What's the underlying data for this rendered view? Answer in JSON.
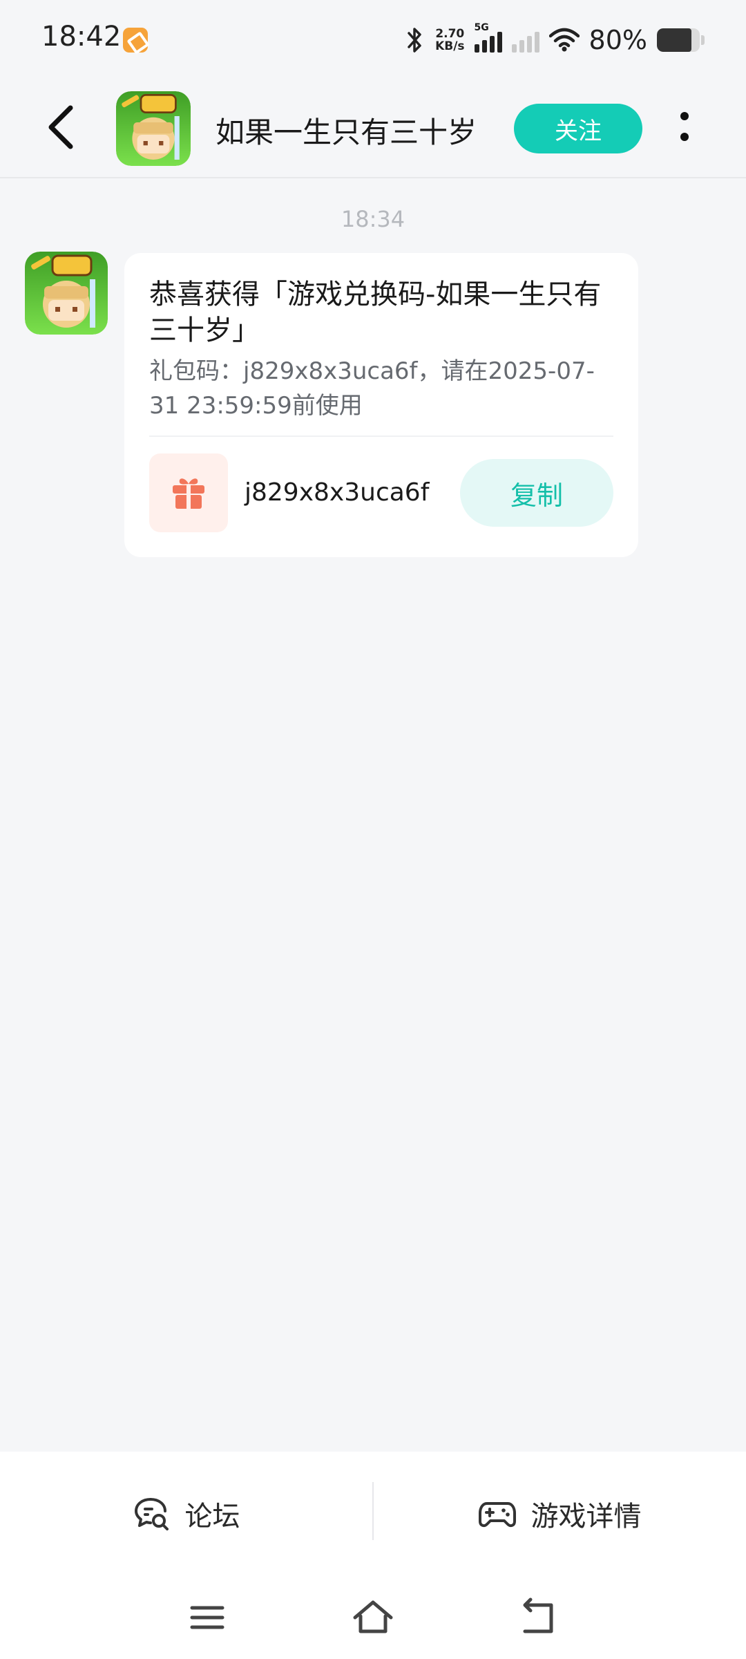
{
  "status_bar": {
    "time": "18:42",
    "speed_value": "2.70",
    "speed_unit": "KB/s",
    "network_label": "5G",
    "battery_text": "80%",
    "battery_level": 0.8
  },
  "header": {
    "title": "如果一生只有三十岁",
    "follow_label": "关注"
  },
  "chat": {
    "time": "18:34",
    "message": {
      "title": "恭喜获得「游戏兑换码-如果一生只有三十岁」",
      "description": "礼包码：j829x8x3uca6f，请在2025-07-31 23:59:59前使用",
      "code": "j829x8x3uca6f",
      "copy_label": "复制"
    }
  },
  "bottom_tabs": [
    {
      "label": "论坛",
      "icon": "forum-icon"
    },
    {
      "label": "游戏详情",
      "icon": "gamepad-icon"
    }
  ],
  "system_nav": [
    "menu-icon",
    "home-icon",
    "back-icon"
  ],
  "colors": {
    "accent": "#14ccb6",
    "background": "#f5f6f8",
    "gift": "#f2765a"
  }
}
